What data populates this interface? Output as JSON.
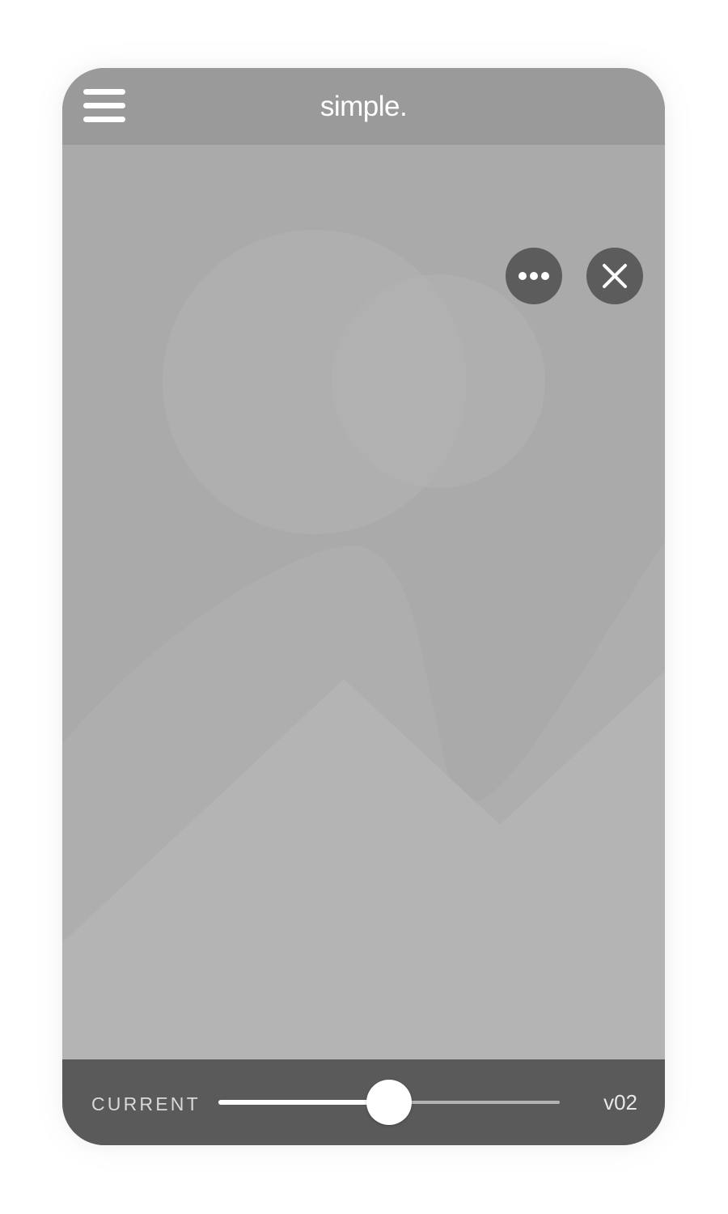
{
  "app": {
    "title": "simple."
  },
  "header": {
    "menu_icon": "hamburger-menu-icon"
  },
  "image_placeholder": {
    "icon": "image-placeholder-icon",
    "actions": [
      {
        "name": "more-options",
        "icon": "ellipsis-icon"
      },
      {
        "name": "close",
        "icon": "close-x-icon"
      }
    ]
  },
  "footer": {
    "current_label": "CURRENT",
    "version_label": "v02",
    "slider_value": 0.5
  },
  "colors": {
    "header_bg": "#9a9a9a",
    "image_bg": "#aaaaaa",
    "footer_bg": "#5a5a5a",
    "button_bg": "#5c5c5c",
    "accent": "#ffffff"
  }
}
